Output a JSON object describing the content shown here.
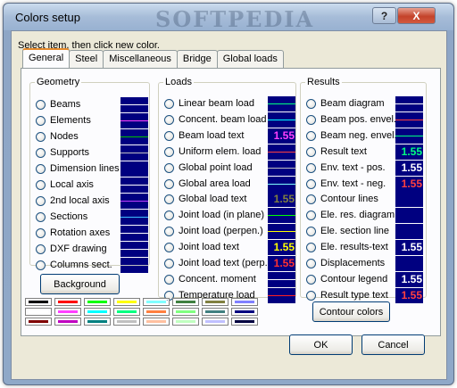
{
  "window": {
    "title": "Colors setup",
    "watermark": "SOFTPEDIA",
    "help_label": "?",
    "close_label": "X"
  },
  "tabs": [
    {
      "label": "General",
      "active": true
    },
    {
      "label": "Steel",
      "active": false
    },
    {
      "label": "Miscellaneous",
      "active": false
    },
    {
      "label": "Bridge",
      "active": false
    },
    {
      "label": "Global loads",
      "active": false
    }
  ],
  "hint": "Select item, then click new color.",
  "groups": {
    "geometry": {
      "title": "Geometry",
      "items": [
        {
          "label": "Beams",
          "line": "#ffffff",
          "text": "",
          "text_color": ""
        },
        {
          "label": "Elements",
          "line": "#ff40ff",
          "text": "",
          "text_color": ""
        },
        {
          "label": "Nodes",
          "line": "#00c000",
          "text": "",
          "text_color": ""
        },
        {
          "label": "Supports",
          "line": "#c0c0c0",
          "text": "",
          "text_color": ""
        },
        {
          "label": "Dimension lines",
          "line": "#000080",
          "text": "",
          "text_color": ""
        },
        {
          "label": "Local axis",
          "line": "#ffffff",
          "text": "",
          "text_color": ""
        },
        {
          "label": "2nd local axis",
          "line": "#c040ff",
          "text": "",
          "text_color": ""
        },
        {
          "label": "Sections",
          "line": "#40c0ff",
          "text": "",
          "text_color": ""
        },
        {
          "label": "Rotation axes",
          "line": "#ffffff",
          "text": "",
          "text_color": ""
        },
        {
          "label": "DXF drawing",
          "line": "#ffffff",
          "text": "",
          "text_color": ""
        },
        {
          "label": "Columns sect.",
          "line": "#c0c0c0",
          "text": "",
          "text_color": ""
        }
      ]
    },
    "loads": {
      "title": "Loads",
      "items": [
        {
          "label": "Linear beam load",
          "line": "#00ff80",
          "text": "",
          "text_color": ""
        },
        {
          "label": "Concent. beam load",
          "line": "#00ffff",
          "text": "",
          "text_color": ""
        },
        {
          "label": "Beam load text",
          "line": "",
          "text": "1.55",
          "text_color": "#ff40ff"
        },
        {
          "label": "Uniform elem. load",
          "line": "#ff4040",
          "text": "",
          "text_color": ""
        },
        {
          "label": "Global point load",
          "line": "#c0c0c0",
          "text": "",
          "text_color": ""
        },
        {
          "label": "Global area load",
          "line": "#80ffff",
          "text": "",
          "text_color": ""
        },
        {
          "label": "Global load text",
          "line": "",
          "text": "1.55",
          "text_color": "#808040"
        },
        {
          "label": "Joint load (in plane)",
          "line": "#00ff00",
          "text": "",
          "text_color": ""
        },
        {
          "label": "Joint load (perpen.)",
          "line": "#ffff00",
          "text": "",
          "text_color": ""
        },
        {
          "label": "Joint load text",
          "line": "",
          "text": "1.55",
          "text_color": "#ffff00"
        },
        {
          "label": "Joint load text (perp.)",
          "line": "",
          "text": "1.55",
          "text_color": "#ff3030"
        },
        {
          "label": "Concent. moment",
          "line": "#ffffff",
          "text": "",
          "text_color": ""
        },
        {
          "label": "Temperature load",
          "line": "#ff2020",
          "text": "",
          "text_color": ""
        }
      ]
    },
    "results": {
      "title": "Results",
      "items": [
        {
          "label": "Beam diagram",
          "line": "#ffffff",
          "text": "",
          "text_color": ""
        },
        {
          "label": "Beam pos. envel.",
          "line": "#ff4040",
          "text": "",
          "text_color": ""
        },
        {
          "label": "Beam neg. envel.",
          "line": "#00ff80",
          "text": "",
          "text_color": ""
        },
        {
          "label": "Result text",
          "line": "",
          "text": "1.55",
          "text_color": "#00ff80"
        },
        {
          "label": "Env. text - pos.",
          "line": "",
          "text": "1.55",
          "text_color": "#ffffff"
        },
        {
          "label": "Env. text - neg.",
          "line": "",
          "text": "1.55",
          "text_color": "#ff4040"
        },
        {
          "label": "Contour lines",
          "line": "#000080",
          "text": "",
          "text_color": ""
        },
        {
          "label": "Ele. res. diagram",
          "line": "#000080",
          "text": "",
          "text_color": ""
        },
        {
          "label": "Ele. section line",
          "line": "#000080",
          "text": "",
          "text_color": ""
        },
        {
          "label": "Ele. results-text",
          "line": "",
          "text": "1.55",
          "text_color": "#ffffff"
        },
        {
          "label": "Displacements",
          "line": "#000080",
          "text": "",
          "text_color": ""
        },
        {
          "label": "Contour legend",
          "line": "",
          "text": "1.55",
          "text_color": "#ffffff"
        },
        {
          "label": "Result type text",
          "line": "",
          "text": "1.55",
          "text_color": "#ff4040"
        }
      ]
    }
  },
  "buttons": {
    "background": "Background",
    "contour_colors": "Contour colors",
    "ok": "OK",
    "cancel": "Cancel"
  },
  "palette": [
    [
      "#000000",
      "#ff0000",
      "#00ff00",
      "#ffff00",
      "#80ffff",
      "#408040",
      "#808040",
      "#8080ff"
    ],
    [
      "#ffffff",
      "#ff40ff",
      "#00ffff",
      "#00ff80",
      "#ff8040",
      "#80ff80",
      "#408080",
      "#000080"
    ],
    [
      "#800000",
      "#c000c0",
      "#008080",
      "#c0c0c0",
      "#ffc0a0",
      "#c0ffc0",
      "#c0c0ff",
      "#000040"
    ]
  ]
}
